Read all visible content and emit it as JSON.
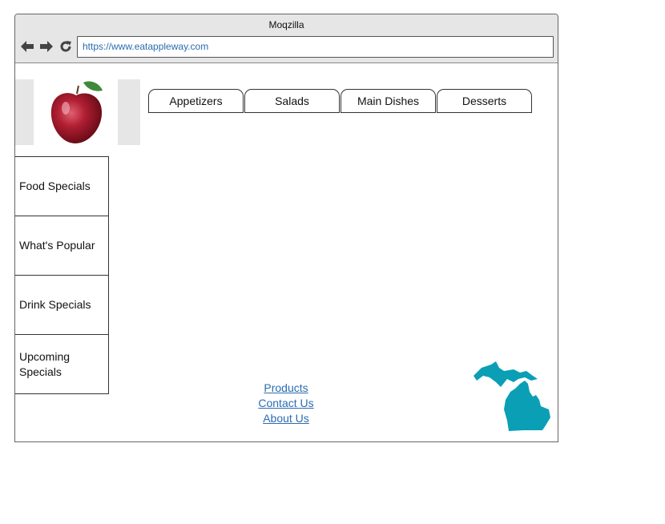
{
  "window": {
    "title": "Moqzilla"
  },
  "browser": {
    "url": "https://www.eatappleway.com",
    "nav_icons": [
      "back-arrow-icon",
      "forward-arrow-icon",
      "reload-icon"
    ]
  },
  "logo": {
    "icon": "apple-icon"
  },
  "tabs": [
    {
      "label": "Appetizers"
    },
    {
      "label": "Salads"
    },
    {
      "label": "Main Dishes"
    },
    {
      "label": "Desserts"
    }
  ],
  "sidebar": {
    "items": [
      {
        "label": "Food Specials"
      },
      {
        "label": "What's Popular"
      },
      {
        "label": "Drink Specials"
      },
      {
        "label": "Upcoming Specials"
      }
    ]
  },
  "footer": {
    "links": [
      {
        "label": "Products"
      },
      {
        "label": "Contact Us"
      },
      {
        "label": "About Us"
      }
    ]
  },
  "map": {
    "icon": "michigan-map-icon",
    "color": "#0a9fb5"
  },
  "colors": {
    "link": "#2b6cb0",
    "chrome": "#e6e6e6"
  }
}
